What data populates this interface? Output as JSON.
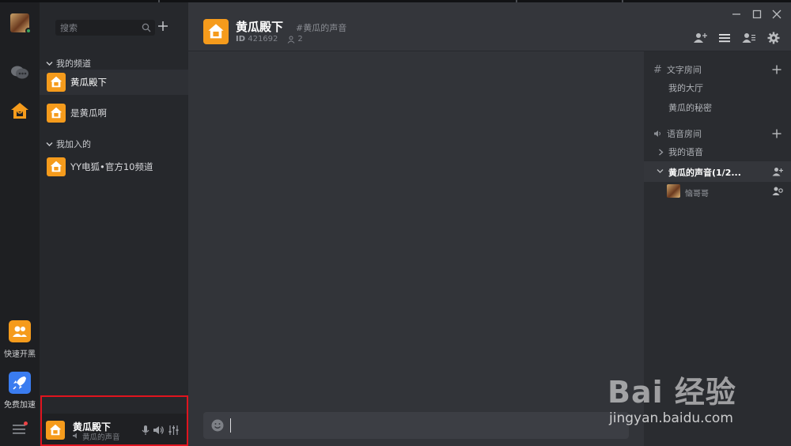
{
  "rail": {
    "quick_label": "快速开黑",
    "boost_label": "免费加速"
  },
  "search": {
    "placeholder": "搜索"
  },
  "channel_list": {
    "my_group": "我的频道",
    "joined_group": "我加入的",
    "my_channels": [
      {
        "label": "黄瓜殿下",
        "active": true
      },
      {
        "label": "是黄瓜啊",
        "active": false
      }
    ],
    "joined_channels": [
      {
        "label": "YY电狐•官方10频道"
      }
    ]
  },
  "userbar": {
    "name": "黄瓜殿下",
    "voice_room": "黄瓜的声音"
  },
  "header": {
    "title": "黄瓜殿下",
    "tag": "#黄瓜的声音",
    "id_label": "ID",
    "id_value": "421692",
    "member_count": "2"
  },
  "rooms": {
    "text_head": "文字房间",
    "text_items": [
      "我的大厅",
      "黄瓜的秘密"
    ],
    "voice_head": "语音房间",
    "voice_items": [
      "我的语音"
    ],
    "active_voice": "黄瓜的声音(1/2...",
    "member_name": "恼哥哥"
  },
  "composer": {
    "placeholder": ""
  },
  "watermark": {
    "logo": "Bai 经验",
    "url": "jingyan.baidu.com"
  },
  "colors": {
    "accent_orange": "#f59b1c",
    "boost_blue": "#3a7cf0",
    "highlight_red": "#e0141e",
    "online_green": "#3ba55d"
  }
}
